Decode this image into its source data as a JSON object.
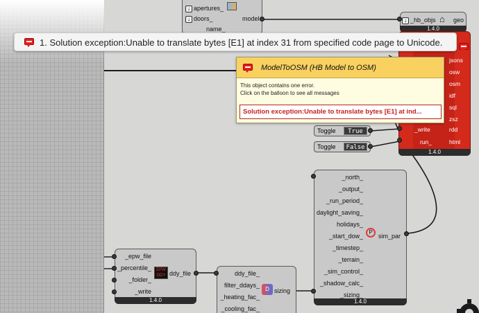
{
  "error_bar": {
    "message": "1. Solution exception:Unable to translate bytes [E1] at index 31 from specified code page to Unicode."
  },
  "tooltip": {
    "title": "ModelToOSM (HB Model to OSM)",
    "line1": "This object contains one error.",
    "line2": "Click on the balloon to see all messages",
    "error_summary": "Solution exception:Unable to translate bytes [E1] at ind..."
  },
  "top_model_component": {
    "inputs": [
      "apertures_",
      "doors_",
      "name_"
    ],
    "output": "model"
  },
  "hb_objs_component": {
    "input": "_hb_objs",
    "output": "geo",
    "version": "1.4.0"
  },
  "model_to_osm": {
    "outputs": [
      "jsons",
      "osw",
      "osm",
      "idf",
      "sql",
      "zsz",
      "rdd",
      "html"
    ],
    "inputs": [
      "_write",
      "run_"
    ],
    "version": "1.4.0"
  },
  "toggles": [
    {
      "label": "Toggle",
      "value": "True"
    },
    {
      "label": "Toggle",
      "value": "False"
    }
  ],
  "sim_par_component": {
    "inputs": [
      "_north_",
      "_output_",
      "_run_period_",
      "daylight_saving_",
      "holidays_",
      "_start_dow_",
      "_timestep_",
      "_terrain_",
      "_sim_control_",
      "_shadow_calc_",
      "_sizing_"
    ],
    "output": "sim_par",
    "version": "1.4.0"
  },
  "ddy_component": {
    "inputs": [
      "_epw_file",
      "_percentile_",
      "_folder_",
      "_write"
    ],
    "output": "ddy_file",
    "icon_text": "EPW DDY",
    "version": "1.4.0"
  },
  "sizing_component": {
    "inputs": [
      "ddy_file_",
      "filter_ddays_",
      "_heating_fac_",
      "_cooling_fac_"
    ],
    "output": "sizing"
  },
  "colors": {
    "error_red": "#d42a1c",
    "tooltip_header": "#f8d160",
    "tooltip_bg": "#fffde1",
    "canvas": "#d7d7d6"
  },
  "icons": [
    "error-balloon-icon",
    "gear-icon",
    "house-icon",
    "sizing-icon"
  ]
}
